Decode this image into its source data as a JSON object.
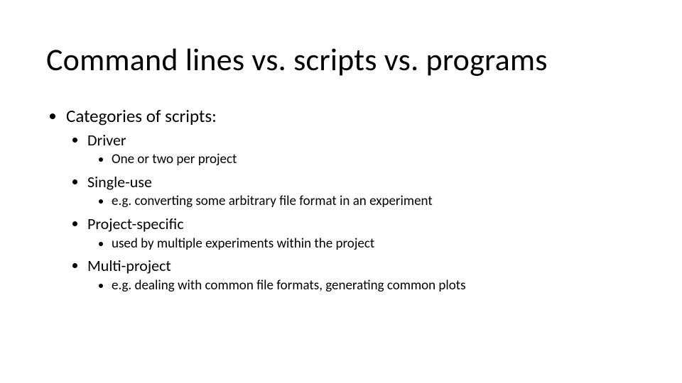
{
  "title": "Command lines vs. scripts vs. programs",
  "l1": {
    "categories": "Categories of scripts:"
  },
  "l2": {
    "driver": "Driver",
    "single_use": "Single-use",
    "project_specific": "Project-specific",
    "multi_project": "Multi-project"
  },
  "l3": {
    "driver_detail": "One or two per project",
    "single_use_detail": "e.g. converting some arbitrary file format in an experiment",
    "project_specific_detail": "used by multiple experiments within the project",
    "multi_project_detail": "e.g. dealing with common file formats, generating common plots"
  }
}
